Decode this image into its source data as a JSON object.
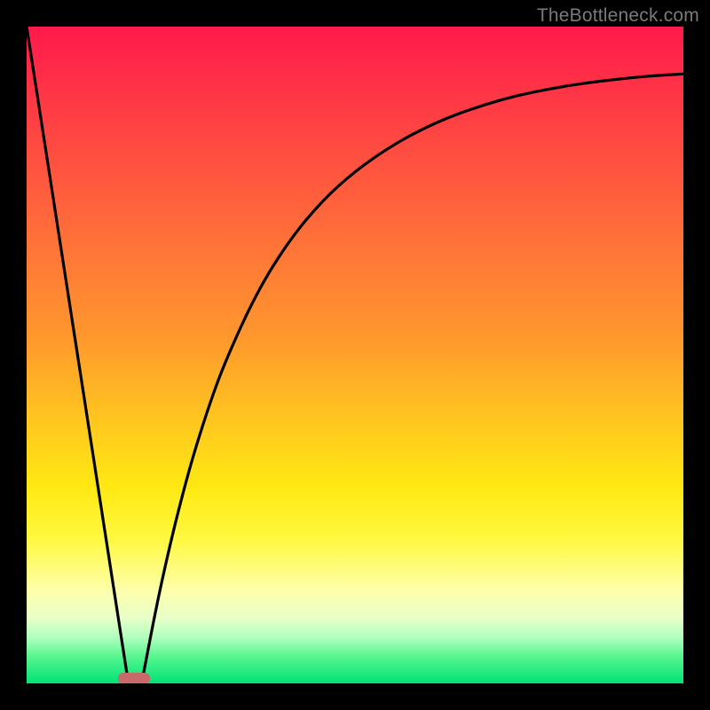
{
  "watermark": "TheBottleneck.com",
  "marker": {
    "x_pct": 16.4,
    "width_pct": 4.9
  },
  "chart_data": {
    "type": "line",
    "title": "",
    "xlabel": "",
    "ylabel": "",
    "xlim": [
      0,
      100
    ],
    "ylim": [
      0,
      100
    ],
    "series": [
      {
        "name": "left-branch",
        "x": [
          0.0,
          4.0,
          8.0,
          12.0,
          15.5
        ],
        "y": [
          100.0,
          74.2,
          48.4,
          22.6,
          0.0
        ]
      },
      {
        "name": "right-branch",
        "x": [
          17.5,
          20.0,
          22.5,
          25.0,
          27.5,
          30.0,
          35.0,
          40.0,
          45.0,
          50.0,
          55.0,
          60.0,
          65.0,
          70.0,
          75.0,
          80.0,
          85.0,
          90.0,
          95.0,
          100.0
        ],
        "y": [
          0.0,
          13.0,
          24.0,
          33.5,
          41.5,
          48.5,
          59.5,
          67.5,
          73.5,
          78.0,
          81.5,
          84.3,
          86.5,
          88.2,
          89.6,
          90.6,
          91.4,
          92.0,
          92.5,
          92.8
        ]
      }
    ],
    "gradient_stops_pct_from_top": {
      "red": 0,
      "orange": 48,
      "yellow": 70,
      "pale": 88,
      "green": 100
    }
  }
}
